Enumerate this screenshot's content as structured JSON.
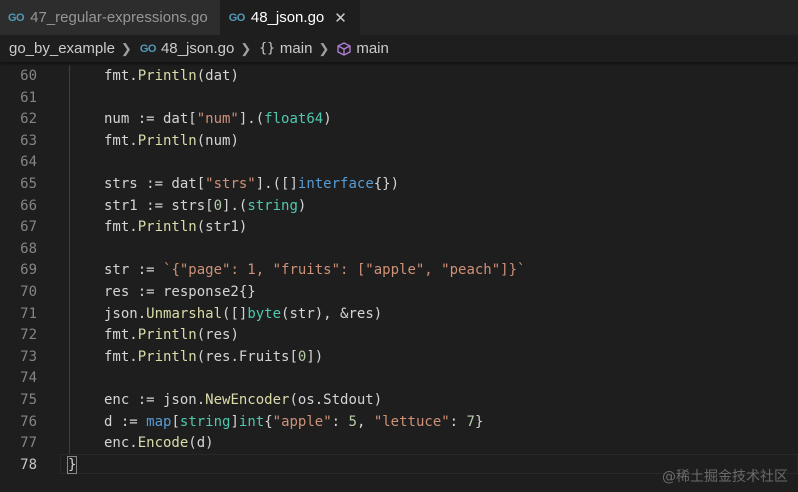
{
  "tabs": [
    {
      "icon": "go-file-icon",
      "icon_text": "GO",
      "label": "47_regular-expressions.go",
      "active": false
    },
    {
      "icon": "go-file-icon",
      "icon_text": "GO",
      "label": "48_json.go",
      "active": true,
      "close": "✕"
    }
  ],
  "breadcrumb": {
    "folder": "go_by_example",
    "file_icon_text": "GO",
    "file": "48_json.go",
    "func_icon": "{}",
    "func": "main",
    "symbol": "main"
  },
  "editor": {
    "lines": [
      {
        "n": "60",
        "tokens": [
          [
            "id",
            "fmt."
          ],
          [
            "fn",
            "Println"
          ],
          [
            "id",
            "(dat)"
          ]
        ]
      },
      {
        "n": "61",
        "tokens": []
      },
      {
        "n": "62",
        "tokens": [
          [
            "id",
            "num := dat["
          ],
          [
            "str",
            "\"num\""
          ],
          [
            "id",
            "].("
          ],
          [
            "type",
            "float64"
          ],
          [
            "id",
            ")"
          ]
        ]
      },
      {
        "n": "63",
        "tokens": [
          [
            "id",
            "fmt."
          ],
          [
            "fn",
            "Println"
          ],
          [
            "id",
            "(num)"
          ]
        ]
      },
      {
        "n": "64",
        "tokens": []
      },
      {
        "n": "65",
        "tokens": [
          [
            "id",
            "strs := dat["
          ],
          [
            "str",
            "\"strs\""
          ],
          [
            "id",
            "].([]"
          ],
          [
            "kw",
            "interface"
          ],
          [
            "id",
            "{})"
          ]
        ]
      },
      {
        "n": "66",
        "tokens": [
          [
            "id",
            "str1 := strs["
          ],
          [
            "num",
            "0"
          ],
          [
            "id",
            "].("
          ],
          [
            "type",
            "string"
          ],
          [
            "id",
            ")"
          ]
        ]
      },
      {
        "n": "67",
        "tokens": [
          [
            "id",
            "fmt."
          ],
          [
            "fn",
            "Println"
          ],
          [
            "id",
            "(str1)"
          ]
        ]
      },
      {
        "n": "68",
        "tokens": []
      },
      {
        "n": "69",
        "tokens": [
          [
            "id",
            "str := "
          ],
          [
            "str",
            "`{\"page\": 1, \"fruits\": [\"apple\", \"peach\"]}`"
          ]
        ]
      },
      {
        "n": "70",
        "tokens": [
          [
            "id",
            "res := response2{}"
          ]
        ]
      },
      {
        "n": "71",
        "tokens": [
          [
            "id",
            "json."
          ],
          [
            "fn",
            "Unmarshal"
          ],
          [
            "id",
            "([]"
          ],
          [
            "type",
            "byte"
          ],
          [
            "id",
            "(str), &res)"
          ]
        ]
      },
      {
        "n": "72",
        "tokens": [
          [
            "id",
            "fmt."
          ],
          [
            "fn",
            "Println"
          ],
          [
            "id",
            "(res)"
          ]
        ]
      },
      {
        "n": "73",
        "tokens": [
          [
            "id",
            "fmt."
          ],
          [
            "fn",
            "Println"
          ],
          [
            "id",
            "(res.Fruits["
          ],
          [
            "num",
            "0"
          ],
          [
            "id",
            "])"
          ]
        ]
      },
      {
        "n": "74",
        "tokens": []
      },
      {
        "n": "75",
        "tokens": [
          [
            "id",
            "enc := json."
          ],
          [
            "fn",
            "NewEncoder"
          ],
          [
            "id",
            "(os.Stdout)"
          ]
        ]
      },
      {
        "n": "76",
        "tokens": [
          [
            "id",
            "d := "
          ],
          [
            "kw",
            "map"
          ],
          [
            "id",
            "["
          ],
          [
            "type",
            "string"
          ],
          [
            "id",
            "]"
          ],
          [
            "type",
            "int"
          ],
          [
            "id",
            "{"
          ],
          [
            "str",
            "\"apple\""
          ],
          [
            "id",
            ": "
          ],
          [
            "num",
            "5"
          ],
          [
            "id",
            ", "
          ],
          [
            "str",
            "\"lettuce\""
          ],
          [
            "id",
            ": "
          ],
          [
            "num",
            "7"
          ],
          [
            "id",
            "}"
          ]
        ]
      },
      {
        "n": "77",
        "tokens": [
          [
            "id",
            "enc."
          ],
          [
            "fn",
            "Encode"
          ],
          [
            "id",
            "(d)"
          ]
        ]
      },
      {
        "n": "78",
        "tokens": [
          [
            "id",
            "}"
          ]
        ],
        "current": true
      }
    ]
  },
  "watermark": "@稀土掘金技术社区"
}
